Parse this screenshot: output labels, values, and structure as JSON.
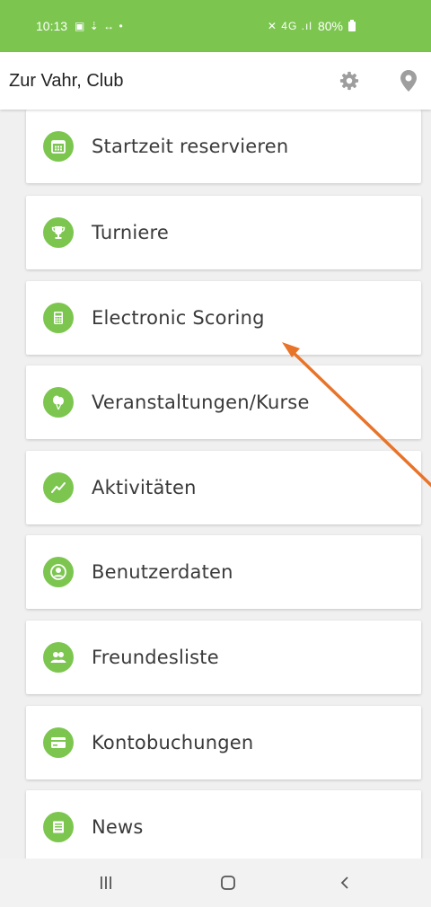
{
  "status_bar": {
    "time": "10:13",
    "left_glyphs": "▣ ⇣ ↔ •",
    "right_glyphs": "✕ 4G .ıl",
    "battery": "80%"
  },
  "header": {
    "title": "Zur Vahr, Club",
    "icons": [
      "gear-icon",
      "location-pin-icon"
    ]
  },
  "menu": {
    "items": [
      {
        "label": "Startzeit reservieren",
        "icon": "calendar-icon"
      },
      {
        "label": "Turniere",
        "icon": "trophy-icon"
      },
      {
        "label": "Electronic Scoring",
        "icon": "calculator-icon"
      },
      {
        "label": "Veranstaltungen/Kurse",
        "icon": "balloons-icon"
      },
      {
        "label": "Aktivitäten",
        "icon": "trend-line-icon"
      },
      {
        "label": "Benutzerdaten",
        "icon": "user-circle-icon"
      },
      {
        "label": "Freundesliste",
        "icon": "group-icon"
      },
      {
        "label": "Kontobuchungen",
        "icon": "credit-card-icon"
      },
      {
        "label": "News",
        "icon": "newspaper-icon"
      }
    ]
  },
  "nav_bar": {
    "icons": [
      "recent-apps-icon",
      "home-icon",
      "back-icon"
    ]
  },
  "colors": {
    "accent": "#7cc650",
    "annotation_arrow": "#e8742a"
  }
}
